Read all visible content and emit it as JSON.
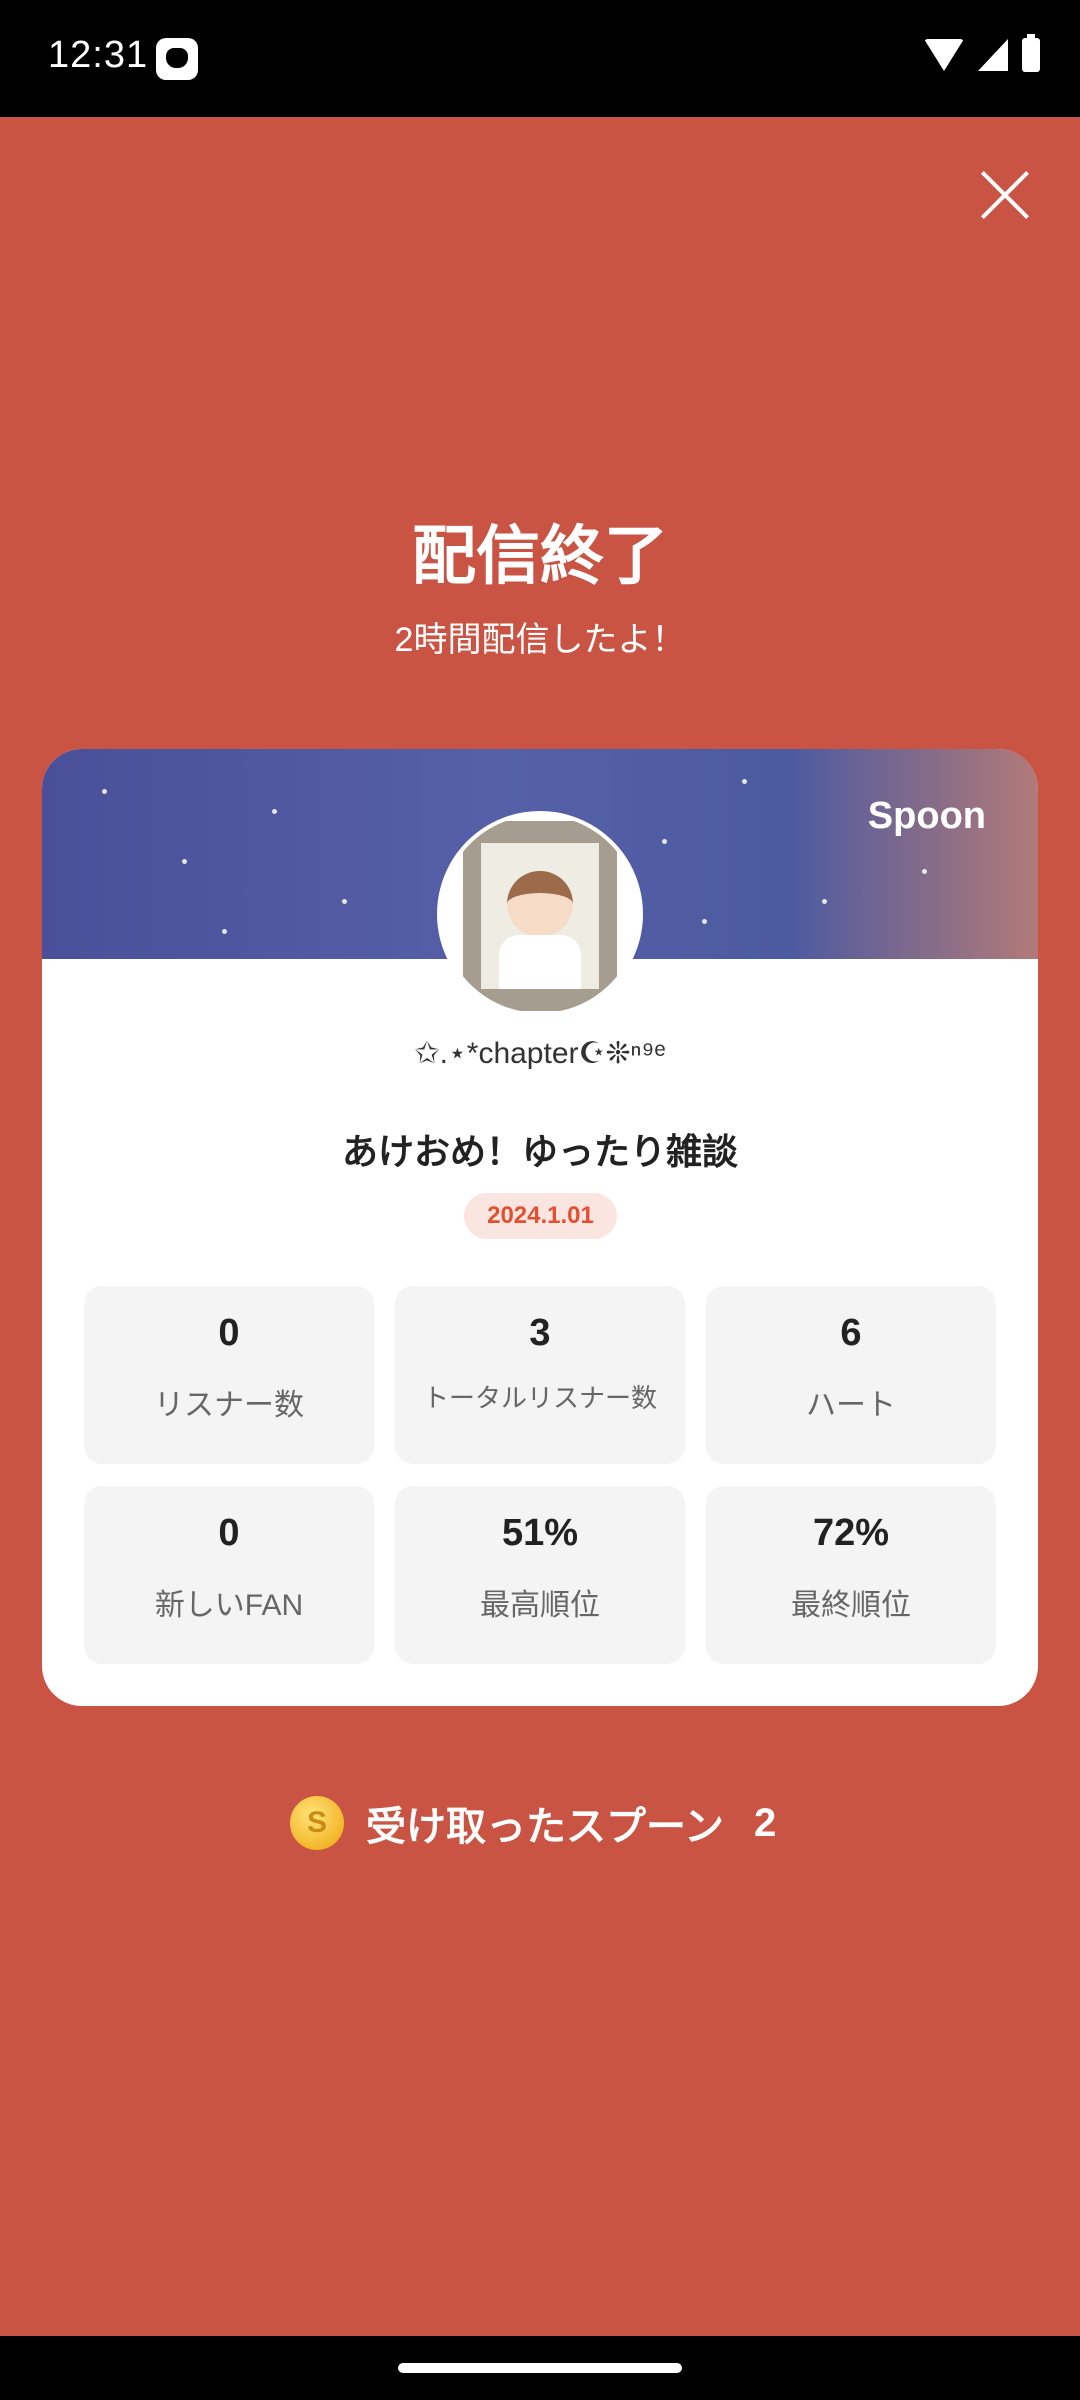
{
  "status_bar": {
    "time": "12:31"
  },
  "header": {
    "title": "配信終了",
    "subtitle": "2時間配信したよ！"
  },
  "card": {
    "brand": "Spoon",
    "username": "✩.⋆*chapter☪︎❊ⁿ⁹ᵉ",
    "broadcast_title": "あけおめ！ゆったり雑談",
    "date": "2024.1.01",
    "stats": [
      {
        "value": "0",
        "label": "リスナー数"
      },
      {
        "value": "3",
        "label": "トータルリスナー数"
      },
      {
        "value": "6",
        "label": "ハート"
      },
      {
        "value": "0",
        "label": "新しいFAN"
      },
      {
        "value": "51%",
        "label": "最高順位"
      },
      {
        "value": "72%",
        "label": "最終順位"
      }
    ]
  },
  "spoons": {
    "coin_symbol": "S",
    "label": "受け取ったスプーン",
    "count": "2"
  },
  "colors": {
    "background": "#c95444",
    "accent": "#e4502f"
  }
}
